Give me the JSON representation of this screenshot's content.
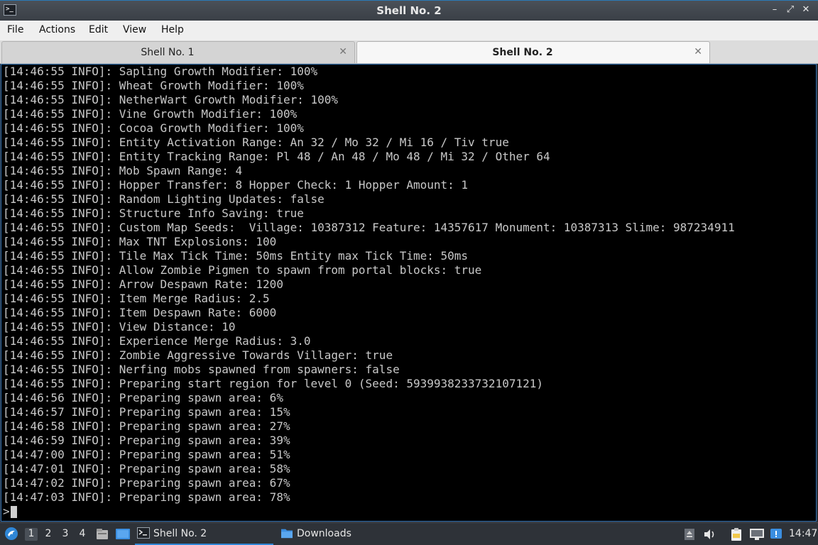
{
  "window": {
    "app_icon_glyph": ">_",
    "title": "Shell No. 2",
    "controls": {
      "minimize": "–",
      "maximize": "⤢",
      "close": "✕"
    }
  },
  "menu": {
    "file": "File",
    "actions": "Actions",
    "edit": "Edit",
    "view": "View",
    "help": "Help"
  },
  "tabs": [
    {
      "label": "Shell No. 1",
      "close": "✕",
      "active": false
    },
    {
      "label": "Shell No. 2",
      "close": "✕",
      "active": true
    }
  ],
  "terminal": {
    "lines": [
      "[14:46:55 INFO]: Sapling Growth Modifier: 100%",
      "[14:46:55 INFO]: Wheat Growth Modifier: 100%",
      "[14:46:55 INFO]: NetherWart Growth Modifier: 100%",
      "[14:46:55 INFO]: Vine Growth Modifier: 100%",
      "[14:46:55 INFO]: Cocoa Growth Modifier: 100%",
      "[14:46:55 INFO]: Entity Activation Range: An 32 / Mo 32 / Mi 16 / Tiv true",
      "[14:46:55 INFO]: Entity Tracking Range: Pl 48 / An 48 / Mo 48 / Mi 32 / Other 64",
      "[14:46:55 INFO]: Mob Spawn Range: 4",
      "[14:46:55 INFO]: Hopper Transfer: 8 Hopper Check: 1 Hopper Amount: 1",
      "[14:46:55 INFO]: Random Lighting Updates: false",
      "[14:46:55 INFO]: Structure Info Saving: true",
      "[14:46:55 INFO]: Custom Map Seeds:  Village: 10387312 Feature: 14357617 Monument: 10387313 Slime: 987234911",
      "[14:46:55 INFO]: Max TNT Explosions: 100",
      "[14:46:55 INFO]: Tile Max Tick Time: 50ms Entity max Tick Time: 50ms",
      "[14:46:55 INFO]: Allow Zombie Pigmen to spawn from portal blocks: true",
      "[14:46:55 INFO]: Arrow Despawn Rate: 1200",
      "[14:46:55 INFO]: Item Merge Radius: 2.5",
      "[14:46:55 INFO]: Item Despawn Rate: 6000",
      "[14:46:55 INFO]: View Distance: 10",
      "[14:46:55 INFO]: Experience Merge Radius: 3.0",
      "[14:46:55 INFO]: Zombie Aggressive Towards Villager: true",
      "[14:46:55 INFO]: Nerfing mobs spawned from spawners: false",
      "[14:46:55 INFO]: Preparing start region for level 0 (Seed: 5939938233732107121)",
      "[14:46:56 INFO]: Preparing spawn area: 6%",
      "[14:46:57 INFO]: Preparing spawn area: 15%",
      "[14:46:58 INFO]: Preparing spawn area: 27%",
      "[14:46:59 INFO]: Preparing spawn area: 39%",
      "[14:47:00 INFO]: Preparing spawn area: 51%",
      "[14:47:01 INFO]: Preparing spawn area: 58%",
      "[14:47:02 INFO]: Preparing spawn area: 67%",
      "[14:47:03 INFO]: Preparing spawn area: 78%"
    ],
    "prompt": ">"
  },
  "taskbar": {
    "workspaces": [
      "1",
      "2",
      "3",
      "4"
    ],
    "active_workspace": "1",
    "tasks": [
      {
        "label": "Shell No. 2",
        "icon": "terminal-icon",
        "active": true
      },
      {
        "label": "Downloads",
        "icon": "folder-icon",
        "active": false
      }
    ],
    "clock": "14:47",
    "accent": "#2f86d6"
  }
}
